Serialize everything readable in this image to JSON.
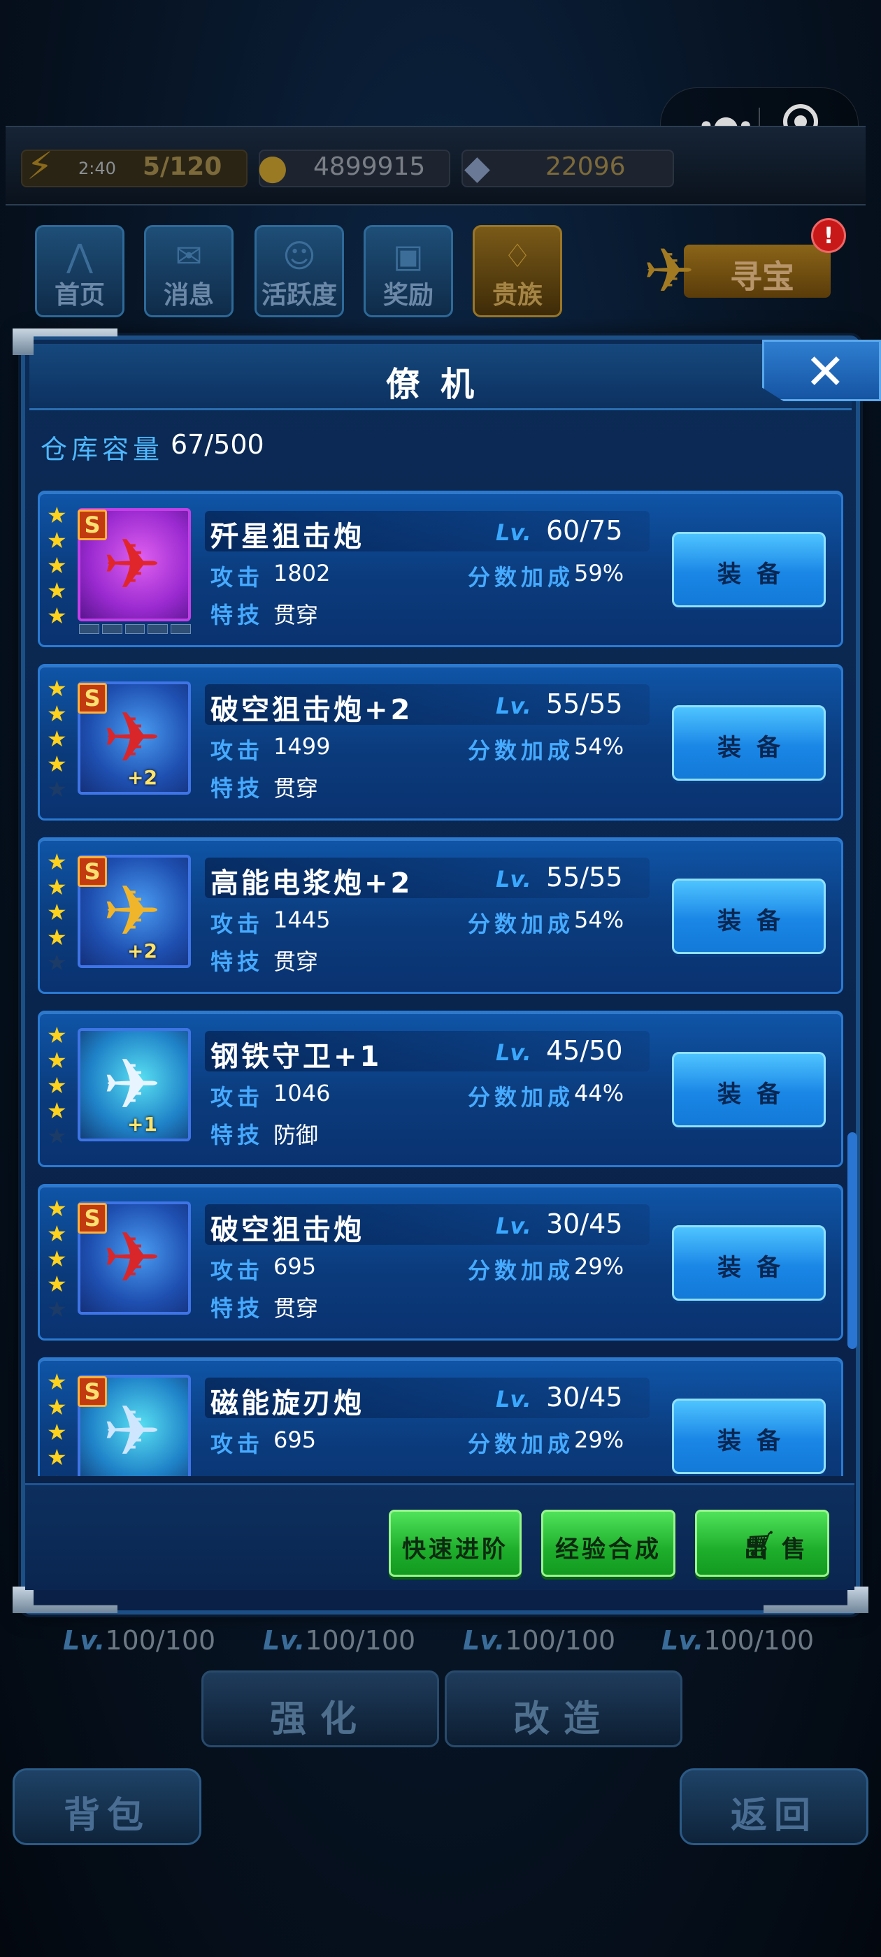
{
  "status_bar": {
    "timer": "2:40",
    "energy": "5/120",
    "gold": "4899915",
    "gems": "22096"
  },
  "nav": [
    {
      "label": "首页",
      "icon": "home-wings-icon"
    },
    {
      "label": "消息",
      "icon": "mail-icon"
    },
    {
      "label": "活跃度",
      "icon": "smile-badge-icon"
    },
    {
      "label": "奖励",
      "icon": "gift-icon"
    },
    {
      "label": "贵族",
      "icon": "crest-icon"
    }
  ],
  "treasure": {
    "label": "寻宝",
    "badge": "!"
  },
  "panel": {
    "title": "僚机",
    "close": "✕",
    "capacity_label": "仓库容量",
    "capacity_value": "67/500"
  },
  "items": [
    {
      "name": "歼星狙击炮",
      "lv_label": "Lv.",
      "lv": "60/75",
      "atk_label": "攻击",
      "atk": "1802",
      "bonus_label": "分数加成",
      "bonus": "59%",
      "skill_label": "特技",
      "skill": "贯穿",
      "stars": 5,
      "rank": "S",
      "plus": "",
      "equip": "装备"
    },
    {
      "name": "破空狙击炮+2",
      "lv_label": "Lv.",
      "lv": "55/55",
      "atk_label": "攻击",
      "atk": "1499",
      "bonus_label": "分数加成",
      "bonus": "54%",
      "skill_label": "特技",
      "skill": "贯穿",
      "stars": 4,
      "rank": "S",
      "plus": "+2",
      "equip": "装备"
    },
    {
      "name": "高能电浆炮+2",
      "lv_label": "Lv.",
      "lv": "55/55",
      "atk_label": "攻击",
      "atk": "1445",
      "bonus_label": "分数加成",
      "bonus": "54%",
      "skill_label": "特技",
      "skill": "贯穿",
      "stars": 4,
      "rank": "S",
      "plus": "+2",
      "equip": "装备"
    },
    {
      "name": "钢铁守卫+1",
      "lv_label": "Lv.",
      "lv": "45/50",
      "atk_label": "攻击",
      "atk": "1046",
      "bonus_label": "分数加成",
      "bonus": "44%",
      "skill_label": "特技",
      "skill": "防御",
      "stars": 4,
      "rank": "",
      "plus": "+1",
      "equip": "装备"
    },
    {
      "name": "破空狙击炮",
      "lv_label": "Lv.",
      "lv": "30/45",
      "atk_label": "攻击",
      "atk": "695",
      "bonus_label": "分数加成",
      "bonus": "29%",
      "skill_label": "特技",
      "skill": "贯穿",
      "stars": 4,
      "rank": "S",
      "plus": "",
      "equip": "装备"
    },
    {
      "name": "磁能旋刃炮",
      "lv_label": "Lv.",
      "lv": "30/45",
      "atk_label": "攻击",
      "atk": "695",
      "bonus_label": "分数加成",
      "bonus": "29%",
      "skill_label": "特技",
      "skill": "",
      "stars": 4,
      "rank": "S",
      "plus": "",
      "equip": "装备"
    }
  ],
  "footer": {
    "quick": "快速进阶",
    "merge": "经验合成",
    "sell": "出 售"
  },
  "background": {
    "levels": [
      "100/100",
      "100/100",
      "100/100",
      "100/100"
    ],
    "lv_prefix": "Lv.",
    "enhance": "强化",
    "modify": "改造",
    "bag": "背包",
    "back": "返回"
  }
}
